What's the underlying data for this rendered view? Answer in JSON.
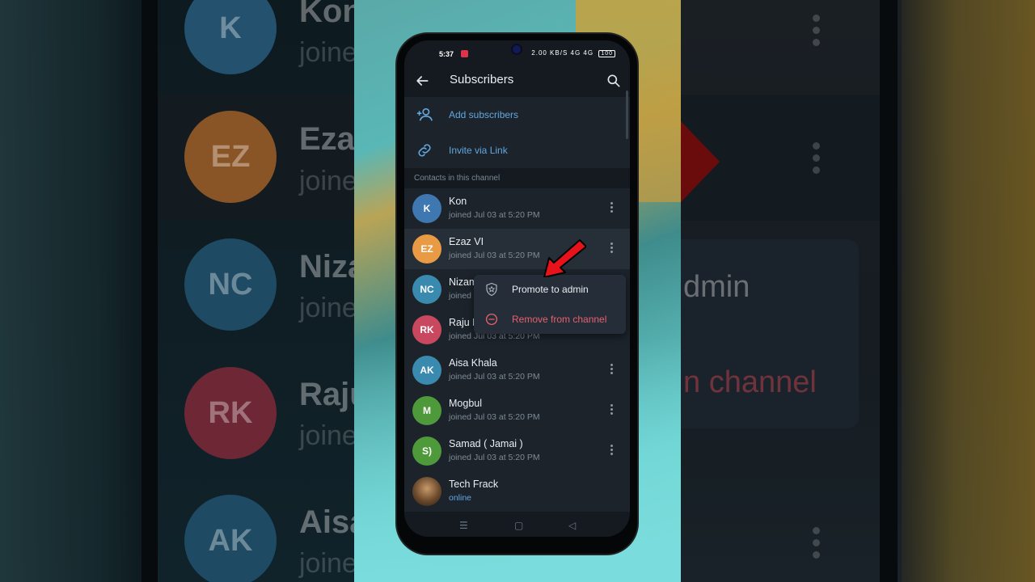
{
  "status_bar": {
    "time": "5:37",
    "icons": "2.00 KB/S 4G 4G",
    "battery": "100"
  },
  "header": {
    "title": "Subscribers"
  },
  "actions": [
    {
      "label": "Add subscribers"
    },
    {
      "label": "Invite via Link"
    }
  ],
  "section_label": "Contacts in this channel",
  "contacts": [
    {
      "initials": "K",
      "name": "Kon",
      "status": "joined Jul 03 at 5:20 PM",
      "color": "#3f78b0"
    },
    {
      "initials": "EZ",
      "name": "Ezaz VI",
      "status": "joined Jul 03 at 5:20 PM",
      "color": "#e89a44"
    },
    {
      "initials": "NC",
      "name": "Nizam",
      "status": "joined Jul 03 at 5:20 PM",
      "color": "#3a8ab0"
    },
    {
      "initials": "RK",
      "name": "Raju Khan",
      "status": "joined Jul 03 at 5:20 PM",
      "color": "#c9485f"
    },
    {
      "initials": "AK",
      "name": "Aisa Khala",
      "status": "joined Jul 03 at 5:20 PM",
      "color": "#3a8ab0"
    },
    {
      "initials": "M",
      "name": "Mogbul",
      "status": "joined Jul 03 at 5:20 PM",
      "color": "#4e9a3a"
    },
    {
      "initials": "S)",
      "name": "Samad ( Jamai )",
      "status": "joined Jul 03 at 5:20 PM",
      "color": "#4e9a3a"
    },
    {
      "initials": "",
      "name": "Tech Frack",
      "status": "online",
      "color": "#6b4a2c"
    }
  ],
  "context_menu": {
    "promote": "Promote to admin",
    "remove": "Remove from channel"
  },
  "background": {
    "names": [
      "Kon",
      "Eza",
      "Niza",
      "Raju",
      "Aisa"
    ],
    "sub": "joine",
    "menu_promote": "dmin",
    "menu_remove": "n channel",
    "initials": [
      "K",
      "EZ",
      "NC",
      "RK",
      "AK"
    ]
  },
  "colors": {
    "accent": "#62a7e0",
    "danger": "#e5606e",
    "arrow": "#e8121a"
  }
}
